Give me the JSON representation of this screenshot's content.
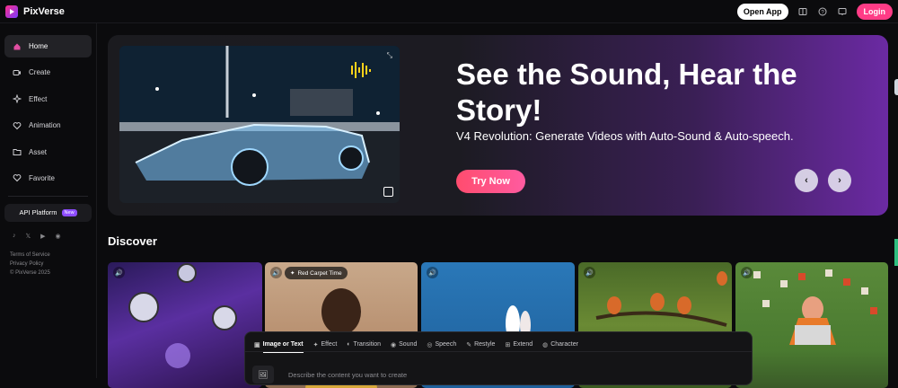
{
  "app": {
    "name": "PixVerse"
  },
  "topbar": {
    "open_app": "Open App",
    "login": "Login"
  },
  "sidebar": {
    "items": [
      {
        "label": "Home",
        "icon": "home-icon"
      },
      {
        "label": "Create",
        "icon": "video-camera-icon"
      },
      {
        "label": "Effect",
        "icon": "sparkle-icon"
      },
      {
        "label": "Animation",
        "icon": "heart-icon"
      },
      {
        "label": "Asset",
        "icon": "folder-icon"
      },
      {
        "label": "Favorite",
        "icon": "heart-outline-icon"
      }
    ],
    "api_platform": "API Platform",
    "api_badge": "New",
    "legal": {
      "terms": "Terms of Service",
      "privacy": "Privacy Policy",
      "copyright": "© PixVerse 2025"
    }
  },
  "hero": {
    "title": "See the Sound, Hear the Story!",
    "subtitle": "V4 Revolution: Generate Videos with Auto-Sound & Auto-speech.",
    "cta": "Try Now"
  },
  "discover": {
    "heading": "Discover",
    "cards": [
      {
        "tag": ""
      },
      {
        "tag": "Red Carpet Time"
      },
      {
        "tag": ""
      },
      {
        "tag": ""
      },
      {
        "tag": ""
      }
    ]
  },
  "prompt": {
    "tabs": [
      {
        "label": "Image or Text",
        "icon": "image-icon"
      },
      {
        "label": "Effect",
        "icon": "sparkle-icon"
      },
      {
        "label": "Transition",
        "icon": "transition-icon"
      },
      {
        "label": "Sound",
        "icon": "sound-icon"
      },
      {
        "label": "Speech",
        "icon": "speech-icon"
      },
      {
        "label": "Restyle",
        "icon": "brush-icon"
      },
      {
        "label": "Extend",
        "icon": "extend-icon"
      },
      {
        "label": "Character",
        "icon": "character-icon"
      }
    ],
    "placeholder": "Describe the content you want to create"
  },
  "colors": {
    "accent": "#ff3c86",
    "badge": "#8d4cff"
  }
}
